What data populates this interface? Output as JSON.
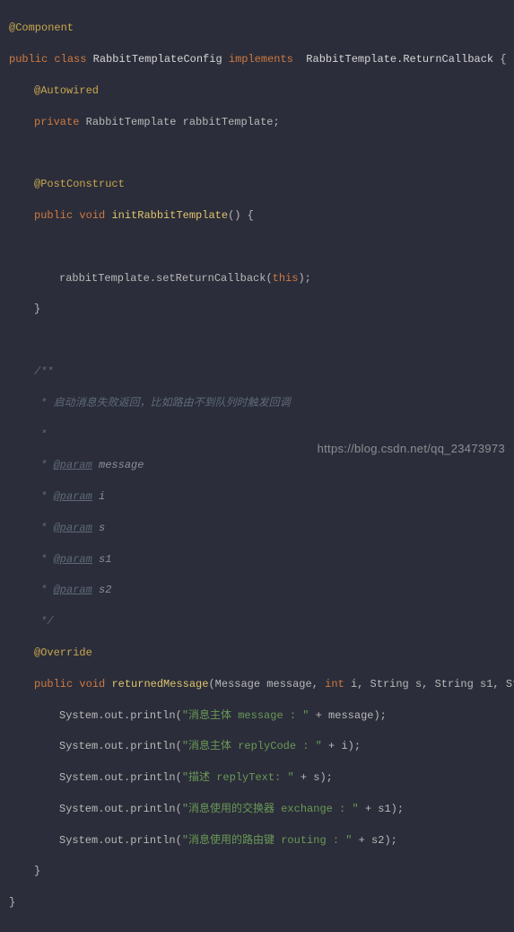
{
  "anno_component": "@Component",
  "kw_public": "public",
  "kw_class": "class",
  "cls_name": "RabbitTemplateConfig",
  "kw_implements": "implements",
  "iface": "RabbitTemplate.ReturnCallback",
  "brace_open": "{",
  "brace_close": "}",
  "anno_autowired": "@Autowired",
  "kw_private": "private",
  "type_rt": "RabbitTemplate",
  "field_rt": "rabbitTemplate",
  "semi": ";",
  "anno_postconstruct": "@PostConstruct",
  "kw_void": "void",
  "m_init": "initRabbitTemplate",
  "parens_empty": "()",
  "call_setrc": "rabbitTemplate.setReturnCallback(",
  "kw_this": "this",
  "call_close": ");",
  "doc_open": "/**",
  "doc_star": " *",
  "doc_line1": " * 启动消息失败返回，比如路由不到队列时触发回调",
  "doc_param": "@param",
  "p_msg": "message",
  "p_i": "i",
  "p_s": "s",
  "p_s1": "s1",
  "p_s2": "s2",
  "doc_close": " */",
  "anno_override": "@Override",
  "m_ret": "returnedMessage",
  "sig_open": "(",
  "t_msg": "Message",
  "a_msg": "message",
  "kw_int": "int",
  "a_i": "i",
  "t_str": "String",
  "a_s": "s",
  "a_s1": "s1",
  "a_s2": "s2",
  "sig_close": ")",
  "comma": ", ",
  "sout": "System.out.println(",
  "str1": "\"消息主体 message : \"",
  "plus_msg": " + message);",
  "str2": "\"消息主体 replyCode : \"",
  "plus_i": " + i);",
  "str3": "\"描述 replyText: \"",
  "plus_s": " + s);",
  "str4": "\"消息使用的交换器 exchange : \"",
  "plus_s1": " + s1);",
  "str5": "\"消息使用的路由键 routing : \"",
  "plus_s2": " + s2);",
  "watermark": "https://blog.csdn.net/qq_23473973"
}
